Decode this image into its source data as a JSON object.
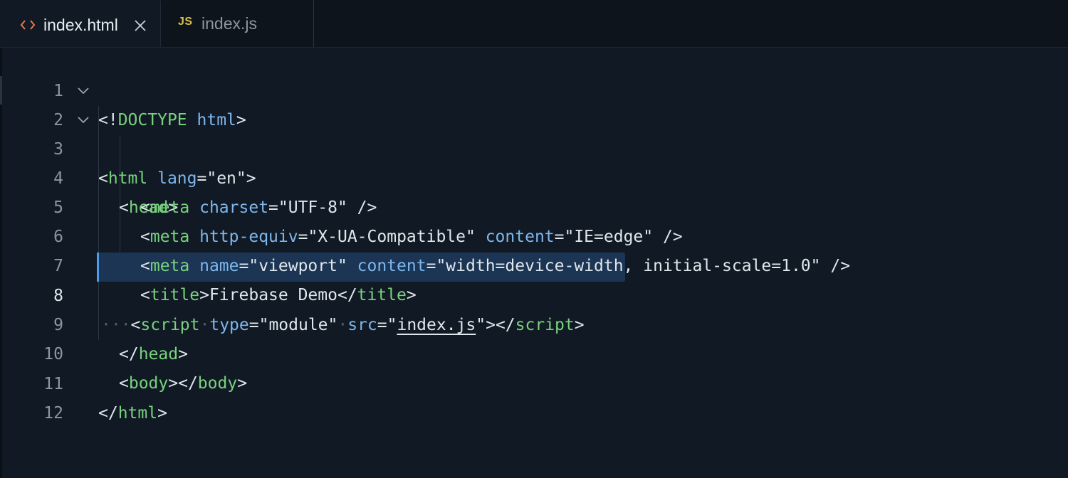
{
  "tabs": [
    {
      "label": "index.html",
      "icon": "html-code-icon",
      "active": true
    },
    {
      "label": "index.js",
      "icon": "js-file-icon",
      "icon_text": "JS",
      "active": false
    }
  ],
  "active_line": 8,
  "lines": {
    "l1": {
      "num": "1",
      "t": [
        "<!",
        "DOCTYPE",
        " ",
        "html",
        ">"
      ]
    },
    "l2": {
      "num": "2",
      "t": [
        "<",
        "html",
        " ",
        "lang",
        "=\"en\">"
      ]
    },
    "l3": {
      "num": "3",
      "t": [
        "<",
        "head",
        ">"
      ]
    },
    "l4": {
      "num": "4",
      "t": [
        "<",
        "meta",
        " ",
        "charset",
        "=\"UTF-8\" />"
      ]
    },
    "l5": {
      "num": "5",
      "t": [
        "<",
        "meta",
        " ",
        "http-equiv",
        "=\"X-UA-Compatible\" ",
        "content",
        "=\"IE=edge\" />"
      ]
    },
    "l6": {
      "num": "6",
      "t": [
        "<",
        "meta",
        " ",
        "name",
        "=\"viewport\" ",
        "content",
        "=\"width=device-width, initial-scale=1.0\" />"
      ]
    },
    "l7": {
      "num": "7",
      "t": [
        "<",
        "title",
        ">Firebase Demo</",
        "title",
        ">"
      ]
    },
    "l8": {
      "num": "8",
      "t": [
        "···",
        "<",
        "script",
        "·",
        "type",
        "=\"module\"",
        "·",
        "src",
        "=\"",
        "index.js",
        "\"></",
        "script",
        ">"
      ]
    },
    "l9": {
      "num": "9",
      "t": [
        "</",
        "head",
        ">"
      ]
    },
    "l10": {
      "num": "10",
      "t": [
        "<",
        "body",
        "></",
        "body",
        ">"
      ]
    },
    "l11": {
      "num": "11",
      "t": [
        "</",
        "html",
        ">"
      ]
    },
    "l12": {
      "num": "12",
      "t": []
    }
  },
  "colors": {
    "background": "#111a24",
    "tag": "#78d27d",
    "attribute": "#7db7ee",
    "text": "#dfe6ec",
    "selection": "#1c3554",
    "html_icon": "#e8774a",
    "js_icon": "#d9c24a"
  }
}
